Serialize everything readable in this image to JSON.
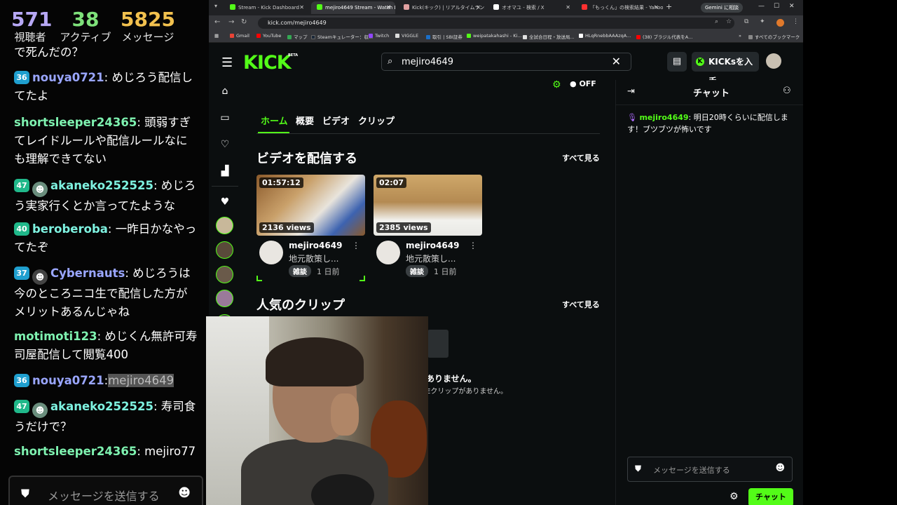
{
  "overlay": {
    "stats": [
      {
        "value": "571",
        "label": "視聴者",
        "color": "#b7a8f5"
      },
      {
        "value": "38",
        "label": "アクティブ",
        "color": "#7ee17a"
      },
      {
        "value": "5825",
        "label": "メッセージ",
        "color": "#f2c14e"
      }
    ],
    "partial_line": "で死んだの？",
    "messages": [
      {
        "badge": "36",
        "badge_color": "#1f9fcf",
        "user": "nouya0721",
        "user_color": "#9aa6ff",
        "avatar": false,
        "text": "めじろう配信してたよ"
      },
      {
        "badge": "",
        "badge_color": "",
        "user": "shortsleeper24365",
        "user_color": "#7ef2b0",
        "avatar": false,
        "text": "頭弱すぎてレイドルールや配信ルールなにも理解できてない"
      },
      {
        "badge": "47",
        "badge_color": "#20b88a",
        "user": "akaneko252525",
        "user_color": "#7ef2e0",
        "avatar": true,
        "text": "めじろう実家行くとか言ってたような"
      },
      {
        "badge": "40",
        "badge_color": "#20b88a",
        "user": "beroberoba",
        "user_color": "#7ef2e0",
        "avatar": false,
        "text": "一昨日かなやってたぞ"
      },
      {
        "badge": "37",
        "badge_color": "#1f9fcf",
        "user": "Cybernauts",
        "user_color": "#9aa6ff",
        "avatar": true,
        "text": "めじろうは今のところニコ生で配信した方がメリットあるんじゃね"
      },
      {
        "badge": "",
        "badge_color": "",
        "user": "motimoti123",
        "user_color": "#7ef2b0",
        "avatar": false,
        "text": "めじくん無許可寿司屋配信して閲覧400"
      },
      {
        "badge": "36",
        "badge_color": "#1f9fcf",
        "user": "nouya0721",
        "user_color": "#9aa6ff",
        "avatar": false,
        "text": "mejiro4649",
        "highlight": true
      },
      {
        "badge": "47",
        "badge_color": "#20b88a",
        "user": "akaneko252525",
        "user_color": "#7ef2e0",
        "avatar": true,
        "text": "寿司食うだけで？"
      },
      {
        "badge": "",
        "badge_color": "",
        "user": "shortsleeper24365",
        "user_color": "#7ef2b0",
        "avatar": false,
        "text": "mejiro77"
      }
    ],
    "input_placeholder": "メッセージを送信する"
  },
  "browser": {
    "tabs": [
      {
        "label": "Stream - Kick Dashboard",
        "icon_color": "#53fc18",
        "active": false
      },
      {
        "label": "mejiro4649 Stream - Watch Live",
        "icon_color": "#53fc18",
        "active": true
      },
      {
        "label": "Kick(キック) | リアルタイムランキング",
        "icon_color": "#e0a0a0",
        "active": false
      },
      {
        "label": "オオマユ - 検索 / X",
        "icon_color": "#ffffff",
        "active": false
      },
      {
        "label": "「もっくん」の検索結果 - Yahoo!検索",
        "icon_color": "#ff3030",
        "active": false
      }
    ],
    "gemini_label": "Gemini に相談",
    "url": "kick.com/mejiro4649",
    "bookmarks": [
      {
        "label": "Gmail",
        "color": "#ea4335"
      },
      {
        "label": "YouTube",
        "color": "#ff0000"
      },
      {
        "label": "マップ",
        "color": "#34a853"
      },
      {
        "label": "Steamキュレーター：収...",
        "color": "#1b2838"
      },
      {
        "label": "Twitch",
        "color": "#9146ff"
      },
      {
        "label": "VIGGLE",
        "color": "#dddddd"
      },
      {
        "label": "取引 | SBI証券",
        "color": "#1a6fc9"
      },
      {
        "label": "weipatakahashi - Ki...",
        "color": "#53fc18"
      },
      {
        "label": "全試合日程・放送局...",
        "color": "#e0e0e0"
      },
      {
        "label": "HLqRnebbAAAzqA...",
        "color": "#ffffff"
      },
      {
        "label": "(38) ブラジル代表をA...",
        "color": "#ff0000"
      }
    ],
    "all_bookmarks": "すべてのブックマーク"
  },
  "kick": {
    "logo": "KICK",
    "beta": "BETA",
    "search_value": "mejiro4649",
    "kicks_label": "KICKsを入手",
    "off_label": "OFF",
    "profile_tabs": [
      "ホーム",
      "概要",
      "ビデオ",
      "クリップ"
    ],
    "videos_heading": "ビデオを配信する",
    "see_all": "すべて見る",
    "clips_heading": "人気のクリップ",
    "videos": [
      {
        "duration": "01:57:12",
        "views": "2136 views",
        "channel": "mejiro4649",
        "title": "地元散策し...",
        "tag": "雑談",
        "ago": "1 日前"
      },
      {
        "duration": "02:07",
        "views": "2385 views",
        "channel": "mejiro4649",
        "title": "地元散策し...",
        "tag": "雑談",
        "ago": "1 日前"
      }
    ],
    "no_clips_title": "ありません。",
    "no_clips_sub": "Eクリップがありません。",
    "chat": {
      "title": "チャット",
      "message_user": "mejiro4649",
      "message_text": "明日20時くらいに配信します！ブツブツが怖いです",
      "input_placeholder": "メッセージを送信する",
      "send_label": "チャット"
    },
    "accent_color": "#53fc18"
  }
}
